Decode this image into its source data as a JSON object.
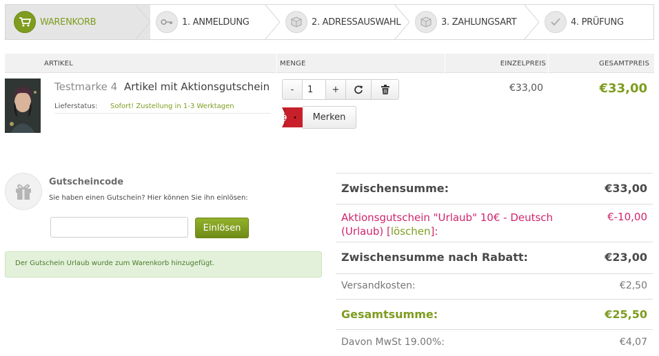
{
  "steps": [
    {
      "label": "WARENKORB",
      "icon": "cart-icon",
      "active": true
    },
    {
      "label": "1. ANMELDUNG",
      "icon": "key-icon",
      "active": false
    },
    {
      "label": "2. ADRESSAUSWAHL",
      "icon": "box-icon",
      "active": false
    },
    {
      "label": "3. ZAHLUNGSART",
      "icon": "box-icon",
      "active": false
    },
    {
      "label": "4. PRÜFUNG",
      "icon": "check-icon",
      "active": false
    }
  ],
  "table": {
    "headers": {
      "artikel": "ARTIKEL",
      "menge": "MENGE",
      "einzelpreis": "EINZELPREIS",
      "gesamtpreis": "GESAMTPREIS"
    }
  },
  "item": {
    "brand": "Testmarke 4",
    "name": "Artikel mit Aktionsgutschein",
    "delivery_label": "Lieferstatus:",
    "delivery_value": "Sofort! Zustellung in 1-3 Werktagen",
    "quantity": "1",
    "minus_label": "-",
    "plus_label": "+",
    "merken_label": "Merken",
    "unit_price": "€33,00",
    "total_price": "€33,00"
  },
  "voucher": {
    "title": "Gutscheincode",
    "hint": "Sie haben einen Gutschein? Hier können Sie ihn einlösen:",
    "input_value": "",
    "button_label": "Einlösen",
    "message": "Der Gutschein Urlaub wurde zum Warenkorb hinzugefügt."
  },
  "totals": {
    "subtotal_label": "Zwischensumme:",
    "subtotal_value": "€33,00",
    "discount_label_a": "Aktionsgutschein \"Urlaub\" 10€ - Deutsch (Urlaub) [",
    "discount_delete": "löschen",
    "discount_label_b": "]:",
    "discount_value": "€-10,00",
    "after_discount_label": "Zwischensumme nach Rabatt:",
    "after_discount_value": "€23,00",
    "shipping_label": "Versandkosten:",
    "shipping_value": "€2,50",
    "grand_total_label": "Gesamtsumme:",
    "grand_total_value": "€25,50",
    "vat_label": "Davon MwSt 19.00%:",
    "vat_value": "€4,07"
  },
  "colors": {
    "accent": "#7e9c1f",
    "discount": "#d0246b",
    "message_bg": "#e3f1da"
  }
}
